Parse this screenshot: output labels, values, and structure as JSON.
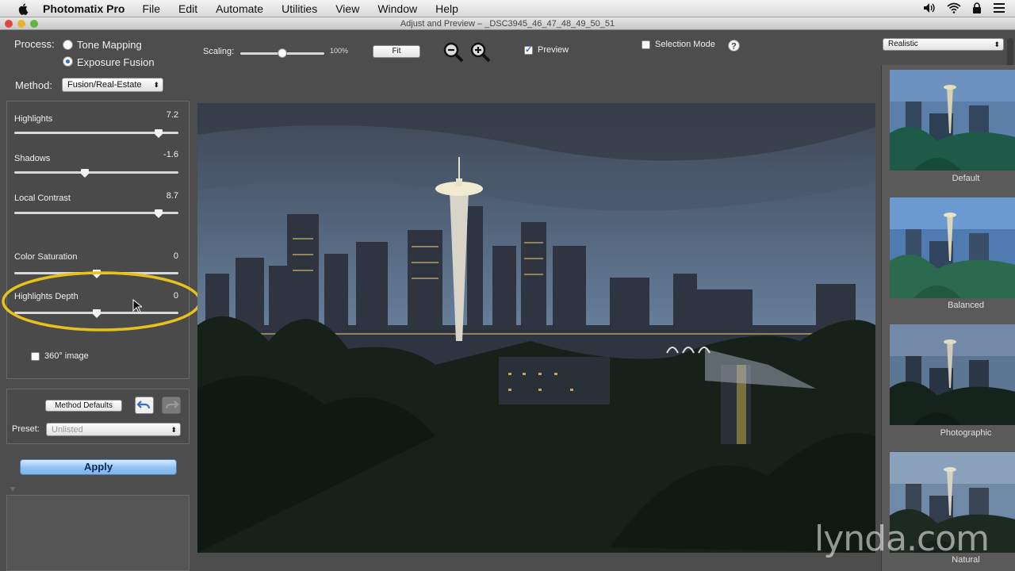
{
  "menubar": {
    "app_name": "Photomatix Pro",
    "items": [
      "File",
      "Edit",
      "Automate",
      "Utilities",
      "View",
      "Window",
      "Help"
    ]
  },
  "window": {
    "title": "Adjust and Preview – _DSC3945_46_47_48_49_50_51"
  },
  "left_panel": {
    "process_label": "Process:",
    "tone_mapping": "Tone Mapping",
    "exposure_fusion": "Exposure Fusion",
    "process_selected": "Exposure Fusion",
    "method_label": "Method:",
    "method_value": "Fusion/Real-Estate",
    "sliders": [
      {
        "label": "Highlights",
        "value": "7.2",
        "level": 0.88
      },
      {
        "label": "Shadows",
        "value": "-1.6",
        "level": 0.43
      },
      {
        "label": "Local Contrast",
        "value": "8.7",
        "level": 0.88
      },
      {
        "label": "Color Saturation",
        "value": "0",
        "level": 0.5
      },
      {
        "label": "Highlights Depth",
        "value": "0",
        "level": 0.5
      }
    ],
    "image_360": "360° image",
    "method_defaults": "Method Defaults",
    "preset_label": "Preset:",
    "preset_value": "Unlisted",
    "apply": "Apply"
  },
  "toolbar": {
    "scaling_label": "Scaling:",
    "scaling_value": "100%",
    "scaling_level": 0.5,
    "fit": "Fit",
    "preview_label": "Preview",
    "preview_checked": true,
    "selection_mode": "Selection Mode",
    "selection_mode_checked": false,
    "style_value": "Realistic"
  },
  "thumbnails": [
    {
      "label": "Default"
    },
    {
      "label": "Balanced"
    },
    {
      "label": "Photographic"
    },
    {
      "label": "Natural"
    }
  ],
  "watermark": "lynda.com",
  "colors": {
    "accent": "#2a6fd6",
    "highlight_ring": "#e8c21c",
    "apply": "#8fc2f2"
  }
}
